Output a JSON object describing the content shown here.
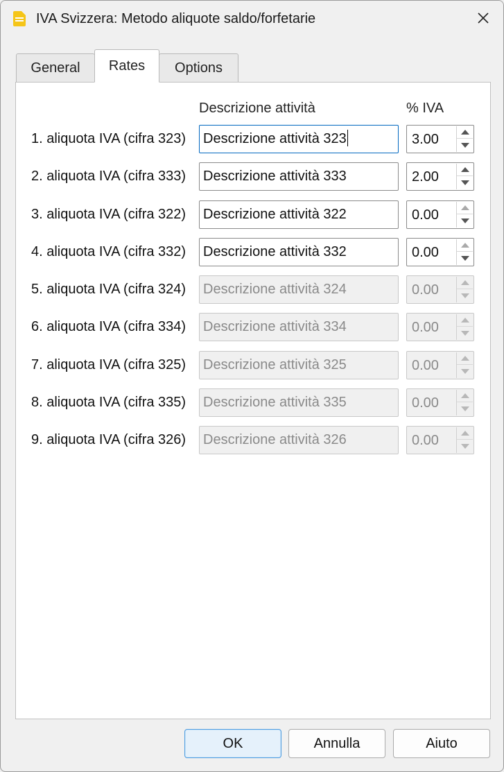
{
  "window": {
    "title": "IVA Svizzera: Metodo aliquote saldo/forfetarie",
    "app_icon": "file-icon",
    "close_icon": "close-icon"
  },
  "tabs": [
    {
      "label": "General",
      "active": false
    },
    {
      "label": "Rates",
      "active": true
    },
    {
      "label": "Options",
      "active": false
    }
  ],
  "columns": {
    "description": "Descrizione attività",
    "rate": "% IVA"
  },
  "rows": [
    {
      "label": "1. aliquota IVA (cifra 323)",
      "description": "Descrizione attività 323",
      "rate": "3.00",
      "enabled": true
    },
    {
      "label": "2. aliquota IVA (cifra 333)",
      "description": "Descrizione attività 333",
      "rate": "2.00",
      "enabled": true
    },
    {
      "label": "3. aliquota IVA (cifra 322)",
      "description": "Descrizione attività 322",
      "rate": "0.00",
      "enabled": true
    },
    {
      "label": "4. aliquota IVA (cifra 332)",
      "description": "Descrizione attività 332",
      "rate": "0.00",
      "enabled": true
    },
    {
      "label": "5. aliquota IVA (cifra 324)",
      "description": "Descrizione attività 324",
      "rate": "0.00",
      "enabled": false
    },
    {
      "label": "6. aliquota IVA (cifra 334)",
      "description": "Descrizione attività 334",
      "rate": "0.00",
      "enabled": false
    },
    {
      "label": "7. aliquota IVA (cifra 325)",
      "description": "Descrizione attività 325",
      "rate": "0.00",
      "enabled": false
    },
    {
      "label": "8. aliquota IVA (cifra 335)",
      "description": "Descrizione attività 335",
      "rate": "0.00",
      "enabled": false
    },
    {
      "label": "9. aliquota IVA (cifra 326)",
      "description": "Descrizione attività 326",
      "rate": "0.00",
      "enabled": false
    }
  ],
  "buttons": {
    "ok": "OK",
    "cancel": "Annulla",
    "help": "Aiuto"
  },
  "colors": {
    "accent": "#0067c0",
    "app_icon": "#f5c518"
  }
}
